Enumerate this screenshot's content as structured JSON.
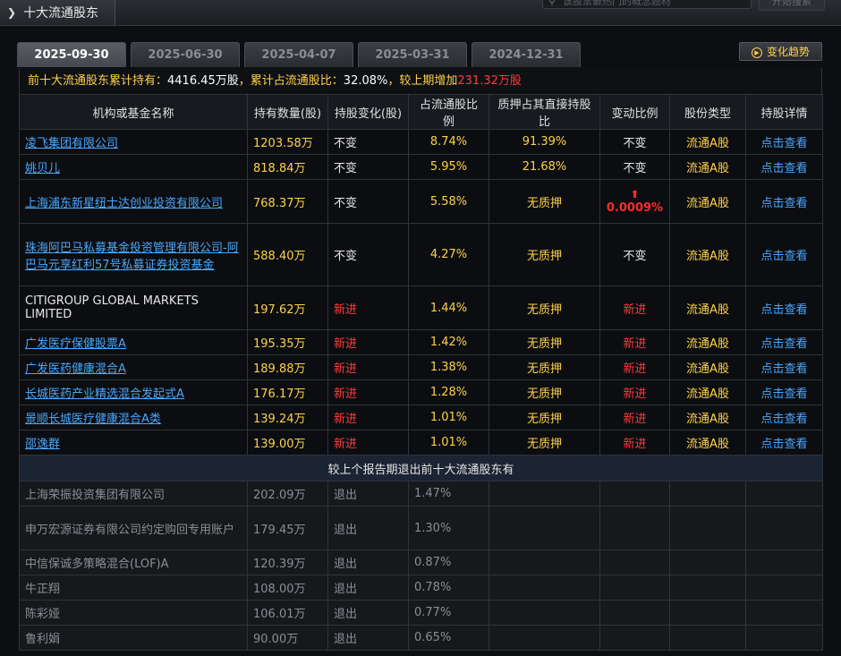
{
  "header": {
    "title": "十大流通股东",
    "search_placeholder": "该股票最热门的概念题材",
    "search_button": "开始搜索"
  },
  "tabs": [
    {
      "label": "2025-09-30",
      "active": true
    },
    {
      "label": "2025-06-30",
      "active": false
    },
    {
      "label": "2025-04-07",
      "active": false
    },
    {
      "label": "2025-03-31",
      "active": false
    },
    {
      "label": "2024-12-31",
      "active": false
    }
  ],
  "trend_button": "变化趋势",
  "summary": {
    "prefix": "前十大流通股东累计持有：",
    "total": "4416.45万股",
    "ratio_label": "，累计占流通股比：",
    "ratio": "32.08%",
    "change_label": "，较上期增加",
    "change": "231.32万股"
  },
  "columns": [
    "机构或基金名称",
    "持有数量(股)",
    "持股变化(股)",
    "占流通股比例",
    "质押占其直接持股比",
    "变动比例",
    "股份类型",
    "持股详情"
  ],
  "holders": [
    {
      "name": "凌飞集团有限公司",
      "linked": true,
      "qty": "1203.58万",
      "change": "不变",
      "ratio": "8.74%",
      "pledge": "91.39%",
      "var": "不变",
      "type": "流通A股",
      "detail": "点击查看"
    },
    {
      "name": "姚贝儿",
      "linked": true,
      "qty": "818.84万",
      "change": "不变",
      "ratio": "5.95%",
      "pledge": "21.68%",
      "var": "不变",
      "type": "流通A股",
      "detail": "点击查看"
    },
    {
      "name": "上海浦东新星纽士达创业投资有限公司",
      "linked": true,
      "qty": "768.37万",
      "change": "不变",
      "ratio": "5.58%",
      "pledge": "无质押",
      "var": "0.0009%",
      "type": "流通A股",
      "detail": "点击查看"
    },
    {
      "name": "珠海阿巴马私募基金投资管理有限公司-阿巴马元享红利57号私募证券投资基金",
      "linked": true,
      "qty": "588.40万",
      "change": "不变",
      "ratio": "4.27%",
      "pledge": "无质押",
      "var": "不变",
      "type": "流通A股",
      "detail": "点击查看"
    },
    {
      "name": "CITIGROUP GLOBAL MARKETS LIMITED",
      "linked": false,
      "qty": "197.62万",
      "change": "新进",
      "ratio": "1.44%",
      "pledge": "无质押",
      "var": "新进",
      "type": "流通A股",
      "detail": "点击查看"
    },
    {
      "name": "广发医疗保健股票A",
      "linked": true,
      "qty": "195.35万",
      "change": "新进",
      "ratio": "1.42%",
      "pledge": "无质押",
      "var": "新进",
      "type": "流通A股",
      "detail": "点击查看"
    },
    {
      "name": "广发医药健康混合A",
      "linked": true,
      "qty": "189.88万",
      "change": "新进",
      "ratio": "1.38%",
      "pledge": "无质押",
      "var": "新进",
      "type": "流通A股",
      "detail": "点击查看"
    },
    {
      "name": "长城医药产业精选混合发起式A",
      "linked": true,
      "qty": "176.17万",
      "change": "新进",
      "ratio": "1.28%",
      "pledge": "无质押",
      "var": "新进",
      "type": "流通A股",
      "detail": "点击查看"
    },
    {
      "name": "景顺长城医疗健康混合A类",
      "linked": true,
      "qty": "139.24万",
      "change": "新进",
      "ratio": "1.01%",
      "pledge": "无质押",
      "var": "新进",
      "type": "流通A股",
      "detail": "点击查看"
    },
    {
      "name": "邵逸群",
      "linked": true,
      "qty": "139.00万",
      "change": "新进",
      "ratio": "1.01%",
      "pledge": "无质押",
      "var": "新进",
      "type": "流通A股",
      "detail": "点击查看"
    }
  ],
  "exit_header": "较上个报告期退出前十大流通股东有",
  "exits": [
    {
      "name": "上海荣振投资集团有限公司",
      "qty": "202.09万",
      "change": "退出",
      "ratio": "1.47%"
    },
    {
      "name": "申万宏源证券有限公司约定购回专用账户",
      "qty": "179.45万",
      "change": "退出",
      "ratio": "1.30%"
    },
    {
      "name": "中信保诚多策略混合(LOF)A",
      "qty": "120.39万",
      "change": "退出",
      "ratio": "0.87%"
    },
    {
      "name": "牛正翔",
      "qty": "108.00万",
      "change": "退出",
      "ratio": "0.78%"
    },
    {
      "name": "陈彩娅",
      "qty": "106.01万",
      "change": "退出",
      "ratio": "0.77%"
    },
    {
      "name": "鲁利娟",
      "qty": "90.00万",
      "change": "退出",
      "ratio": "0.65%"
    }
  ],
  "colors": {
    "accent": "#ffd24a",
    "link": "#4aa8ff",
    "new": "#ff3b3b",
    "bg": "#0c0e12"
  }
}
